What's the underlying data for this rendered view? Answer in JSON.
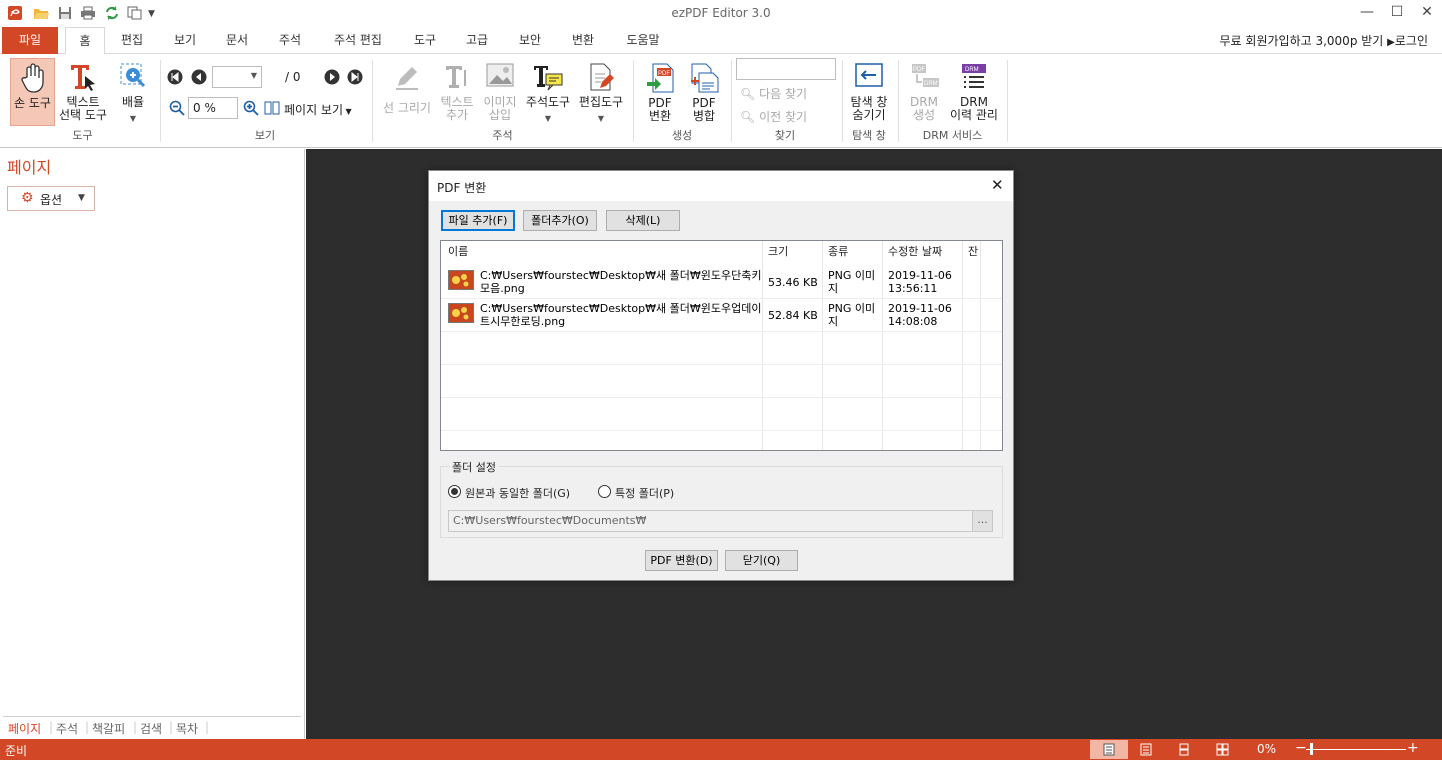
{
  "app": {
    "title": "ezPDF Editor 3.0",
    "accent": "#d24726"
  },
  "tabs": {
    "file": "파일",
    "items": [
      "홈",
      "편집",
      "보기",
      "문서",
      "주석",
      "주석 편집",
      "도구",
      "고급",
      "보안",
      "변환",
      "도움말"
    ]
  },
  "topbar": {
    "signup": "무료 회원가입하고 3,000p 받기",
    "login": "로그인"
  },
  "ribbon": {
    "hand_tool": "손 도구",
    "text_select_1": "텍스트",
    "text_select_2": "선택 도구",
    "zoom": "배율",
    "group_tools": "도구",
    "page_total": "/ 0",
    "zoom_value": "0 %",
    "page_view": "페이지 보기",
    "group_view": "보기",
    "draw_line": "선 그리기",
    "text_add_1": "텍스트",
    "text_add_2": "추가",
    "image_insert_1": "이미지",
    "image_insert_2": "삽입",
    "annot_tool": "주석도구",
    "edit_tool": "편집도구",
    "group_annot": "주석",
    "pdf_convert_1": "PDF",
    "pdf_convert_2": "변환",
    "pdf_merge_1": "PDF",
    "pdf_merge_2": "병합",
    "group_create": "생성",
    "find_next": "다음 찾기",
    "find_prev": "이전 찾기",
    "group_find": "찾기",
    "nav_hide_1": "탐색 창",
    "nav_hide_2": "숨기기",
    "group_nav": "탐색 창",
    "drm_create_1": "DRM",
    "drm_create_2": "생성",
    "drm_history_1": "DRM",
    "drm_history_2": "이력 관리",
    "group_drm": "DRM 서비스"
  },
  "left_panel": {
    "title": "페이지",
    "options": "옵션",
    "tabs": [
      "페이지",
      "주석",
      "책갈피",
      "검색",
      "목차"
    ]
  },
  "status": {
    "ready": "준비",
    "zoom": "0%"
  },
  "dialog": {
    "title": "PDF 변환",
    "add_file": "파일 추가(F)",
    "add_folder": "폴더추가(O)",
    "delete": "삭제(L)",
    "columns": [
      "이름",
      "크기",
      "종류",
      "수정한 날짜",
      "잔"
    ],
    "files": [
      {
        "name_1": "C:₩Users₩fourstec₩Desktop₩새 폴더₩윈도우단축키",
        "name_2": "모음.png",
        "size": "53.46 KB",
        "type_1": "PNG 이미",
        "type_2": "지",
        "date_1": "2019-11-06",
        "date_2": "13:56:11"
      },
      {
        "name_1": "C:₩Users₩fourstec₩Desktop₩새 폴더₩윈도우업데이",
        "name_2": "트시무한로딩.png",
        "size": "52.84 KB",
        "type_1": "PNG 이미",
        "type_2": "지",
        "date_1": "2019-11-06",
        "date_2": "14:08:08"
      }
    ],
    "folder_settings": "폴더 설정",
    "same_folder": "원본과 동일한 폴더(G)",
    "specific_folder": "특정 폴더(P)",
    "path": "C:₩Users₩fourstec₩Documents₩",
    "browse": "...",
    "convert": "PDF 변환(D)",
    "close": "닫기(Q)"
  }
}
